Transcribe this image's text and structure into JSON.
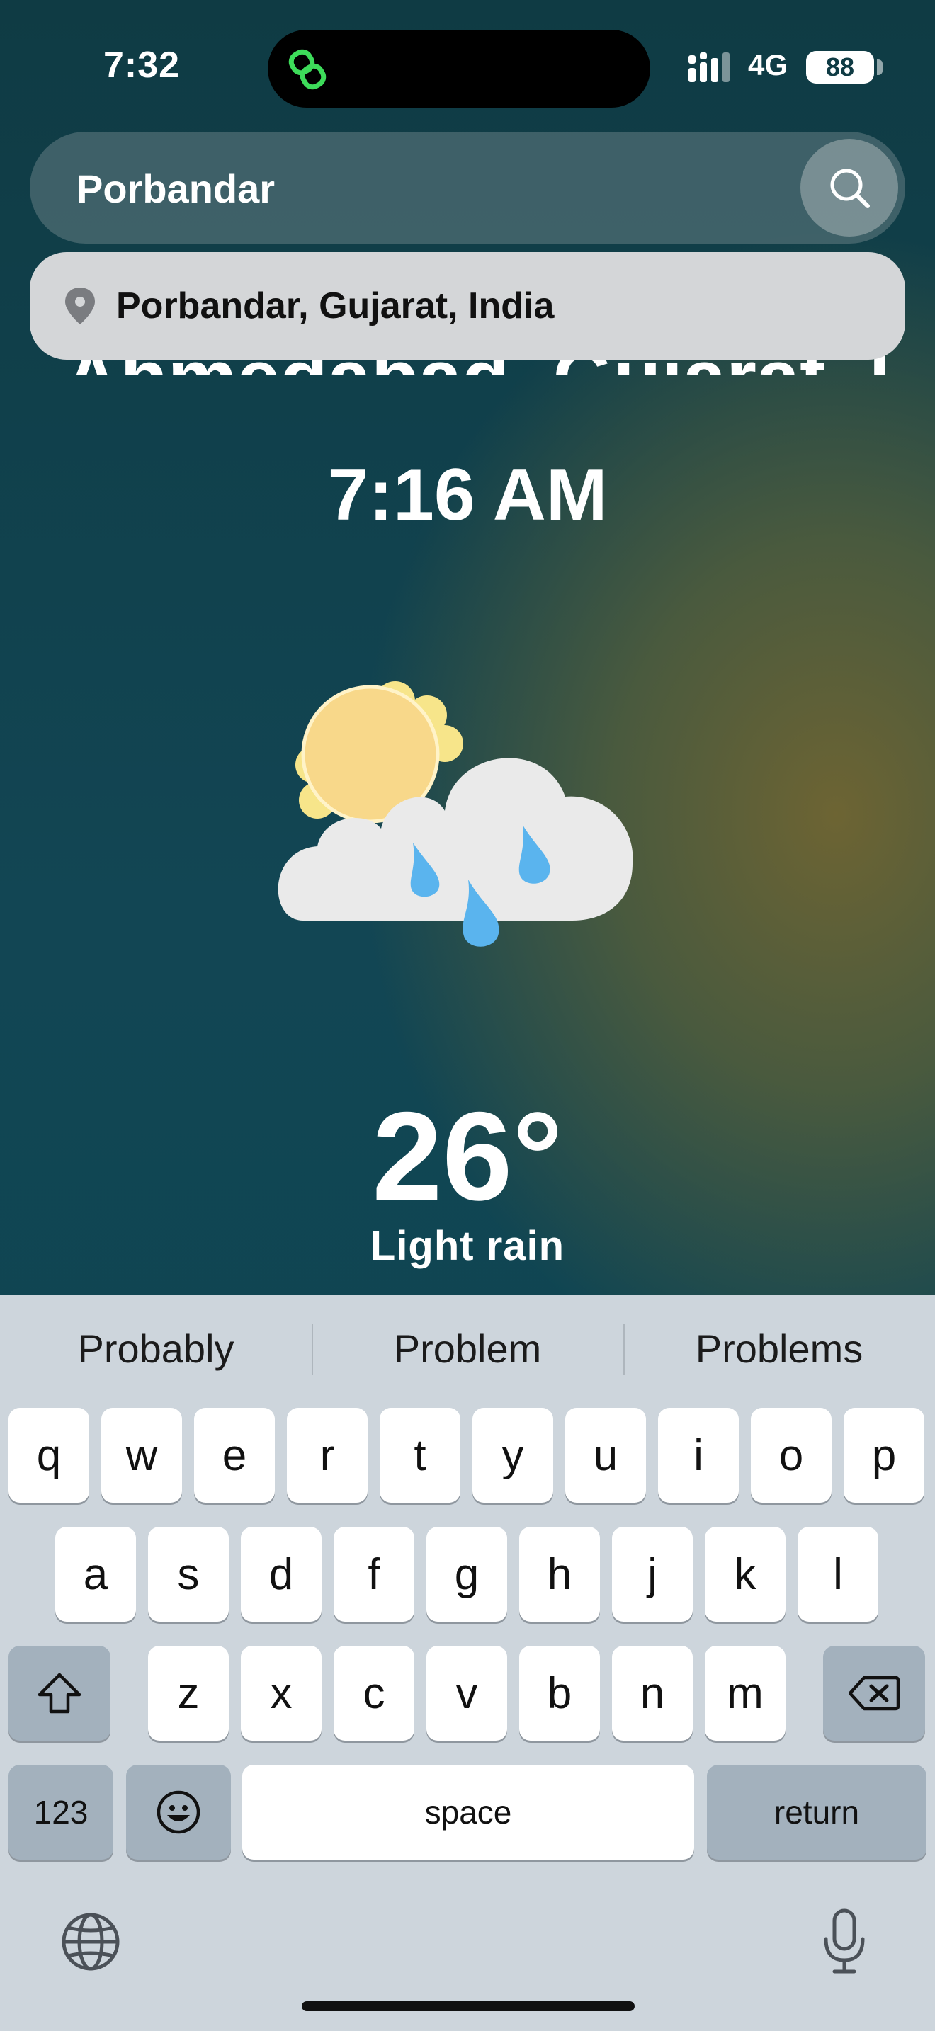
{
  "status_bar": {
    "time": "7:32",
    "network": "4G",
    "battery": "88"
  },
  "search": {
    "value": "Porbandar",
    "placeholder": ""
  },
  "suggestion": {
    "label": "Porbandar, Gujarat, India"
  },
  "location_ghost": "Ahmedabad, Gujarat, India",
  "weather": {
    "time": "7:16 AM",
    "temperature": "26°",
    "condition": "Light rain",
    "icon": "sun-cloud-rain-icon"
  },
  "keyboard": {
    "predictions": [
      "Probably",
      "Problem",
      "Problems"
    ],
    "row1": [
      "q",
      "w",
      "e",
      "r",
      "t",
      "y",
      "u",
      "i",
      "o",
      "p"
    ],
    "row2": [
      "a",
      "s",
      "d",
      "f",
      "g",
      "h",
      "j",
      "k",
      "l"
    ],
    "row3": [
      "z",
      "x",
      "c",
      "v",
      "b",
      "n",
      "m"
    ],
    "numbers_label": "123",
    "space_label": "space",
    "return_label": "return"
  }
}
